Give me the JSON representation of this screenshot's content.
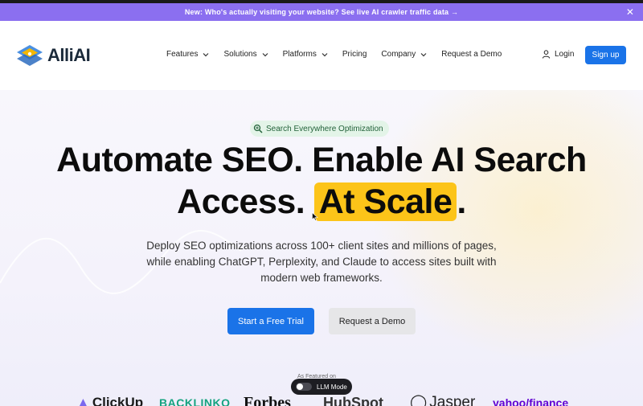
{
  "announcement": {
    "text": "New: Who's actually visiting your website? See live AI crawler traffic data →",
    "close_icon": "close-icon"
  },
  "nav": {
    "logo_text": "AlliAI",
    "menu": [
      {
        "label": "Features",
        "dropdown": true
      },
      {
        "label": "Solutions",
        "dropdown": true
      },
      {
        "label": "Platforms",
        "dropdown": true
      },
      {
        "label": "Pricing",
        "dropdown": false
      },
      {
        "label": "Company",
        "dropdown": true
      },
      {
        "label": "Request a Demo",
        "dropdown": false
      }
    ],
    "login_label": "Login",
    "signup_label": "Sign up"
  },
  "hero": {
    "badge": "Search Everywhere Optimization",
    "headline_line1": "Automate SEO. Enable AI Search",
    "headline_line2_pre": "Access. ",
    "headline_highlight": "At Scale",
    "headline_line2_post": ".",
    "subheading": "Deploy SEO optimizations across 100+ client sites and millions of pages, while enabling ChatGPT, Perplexity, and Claude to access sites built with modern web frameworks.",
    "primary_cta": "Start a Free Trial",
    "secondary_cta": "Request a Demo",
    "featured_label": "As Featured on",
    "llm_mode_label": "LLM Mode",
    "logos": [
      "ClickUp",
      "BACKLINKO",
      "Forbes",
      "HubSpot",
      "Jasper",
      "yahoo/finance"
    ]
  },
  "colors": {
    "announcement_bg": "#8b6ff0",
    "primary_blue": "#1a73e8",
    "highlight_yellow": "#fcc419",
    "badge_green_bg": "#e3f4e8"
  }
}
